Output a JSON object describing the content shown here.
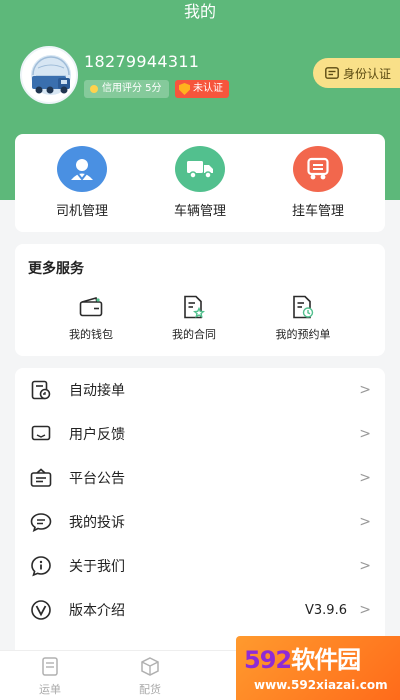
{
  "header": {
    "title": "我的",
    "phone": "18279944311",
    "credit_label": "信用评分 5分",
    "unverified_label": "未认证",
    "verify_button": "身份认证"
  },
  "management": [
    {
      "label": "司机管理",
      "icon": "driver-icon",
      "color": "#4a90e2"
    },
    {
      "label": "车辆管理",
      "icon": "truck-icon",
      "color": "#52c08e"
    },
    {
      "label": "挂车管理",
      "icon": "trailer-icon",
      "color": "#f2674d"
    }
  ],
  "services": {
    "title": "更多服务",
    "items": [
      {
        "label": "我的钱包",
        "icon": "wallet-icon"
      },
      {
        "label": "我的合同",
        "icon": "contract-icon"
      },
      {
        "label": "我的预约单",
        "icon": "reservation-icon"
      }
    ]
  },
  "menu": [
    {
      "label": "自动接单",
      "icon": "auto-order-icon",
      "value": ""
    },
    {
      "label": "用户反馈",
      "icon": "feedback-icon",
      "value": ""
    },
    {
      "label": "平台公告",
      "icon": "announcement-icon",
      "value": ""
    },
    {
      "label": "我的投诉",
      "icon": "complaint-icon",
      "value": ""
    },
    {
      "label": "关于我们",
      "icon": "info-icon",
      "value": ""
    },
    {
      "label": "版本介绍",
      "icon": "version-icon",
      "value": "V3.9.6"
    }
  ],
  "tabs": [
    {
      "label": "运单",
      "icon": "waybill-icon"
    },
    {
      "label": "配货",
      "icon": "cargo-icon"
    }
  ],
  "watermark": {
    "logo_num": "592",
    "logo_text": "软件园",
    "url": "www.592xiazai.com"
  },
  "colors": {
    "brand_green": "#5db87a",
    "accent_yellow": "#f9e089",
    "warning_red": "#f6553c",
    "list_icon": "#2b2b2b"
  }
}
